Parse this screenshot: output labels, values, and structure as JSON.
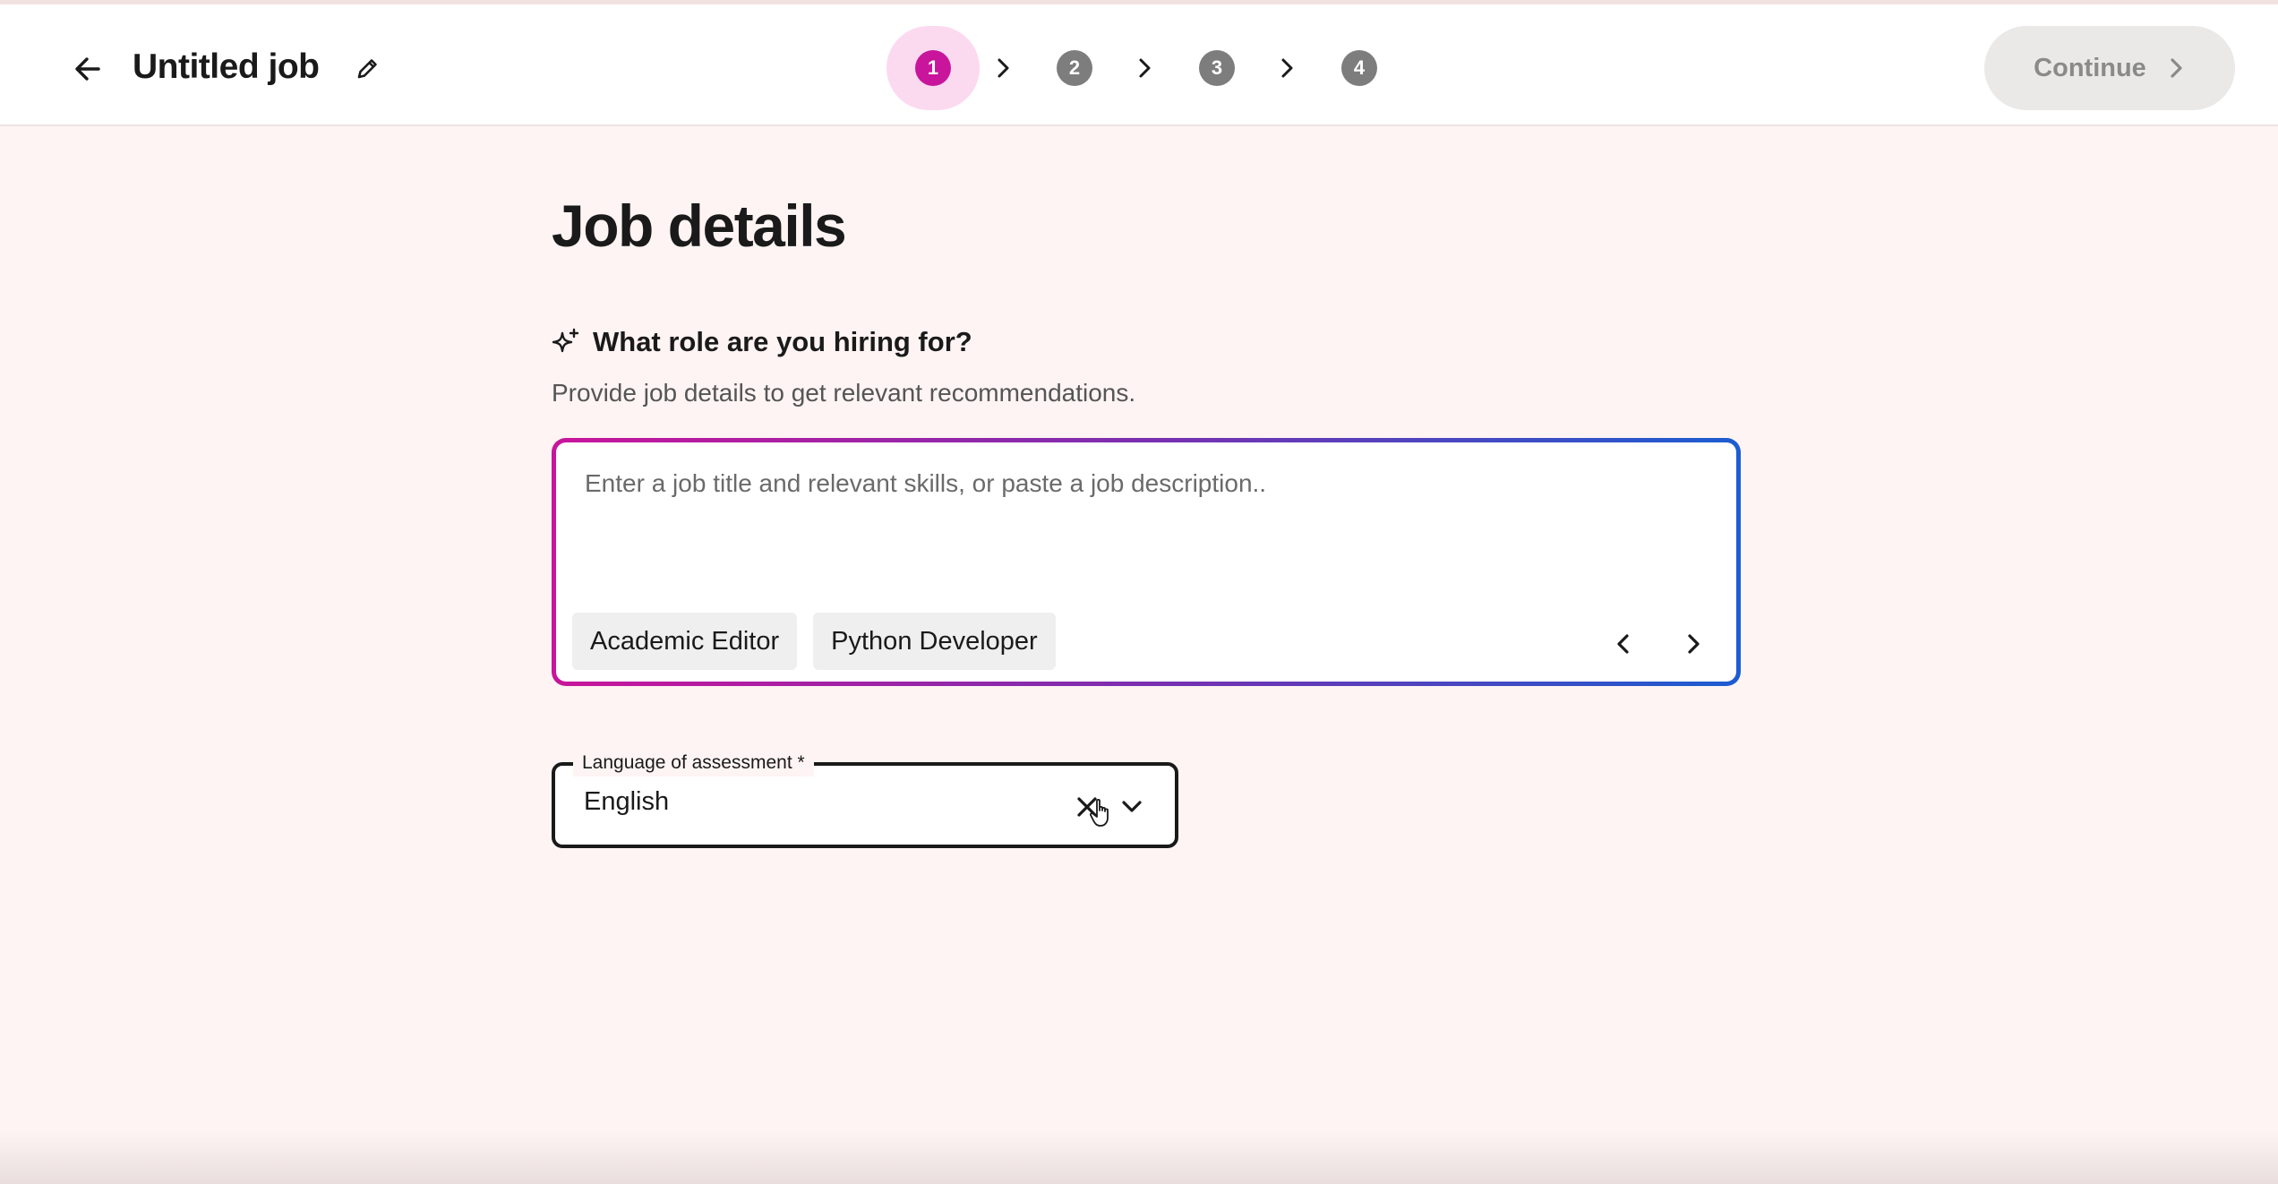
{
  "header": {
    "title": "Untitled job",
    "steps": [
      "1",
      "2",
      "3",
      "4"
    ],
    "active_step": 1,
    "continue_label": "Continue"
  },
  "main": {
    "title": "Job details",
    "question": "What role are you hiring for?",
    "subtext": "Provide job details to get relevant recommendations.",
    "job_input": {
      "placeholder": "Enter a job title and relevant skills, or paste a job description..",
      "value": ""
    },
    "suggestions": [
      "Academic Editor",
      "Python Developer"
    ],
    "language": {
      "label": "Language of assessment *",
      "value": "English"
    }
  },
  "colors": {
    "accent": "#c8159b",
    "active_step_bg": "#fbdaf0",
    "gradient_end": "#1c5dd1",
    "page_bg": "#fef4f3"
  }
}
